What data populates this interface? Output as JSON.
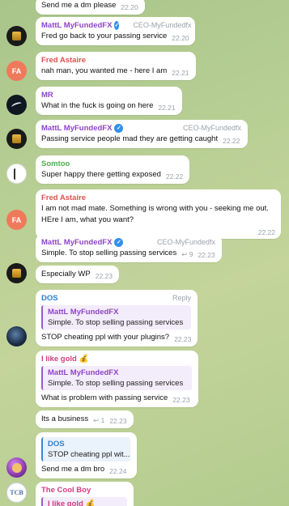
{
  "colors": {
    "matt": "#8e44c9",
    "fred": "#d9534f",
    "mr": "#8e44c9",
    "somtoo": "#4fae4e",
    "dos": "#2f80d1",
    "gold": "#d63b7f",
    "cool": "#d63b7f",
    "verified": "#3390ec"
  },
  "avatars": {
    "fa_initials": "FA",
    "cool_initials": "TCB"
  },
  "messages": {
    "m0": {
      "text": "Send me a dm please",
      "time": "22.20"
    },
    "m1": {
      "sender": "MattL MyFundedFX",
      "badge": "CEO-MyFundedfx",
      "text": "Fred go back to your passing service",
      "time": "22.20"
    },
    "m2": {
      "sender": "Fred Astaire",
      "text": "nah man, you wanted me - here I am",
      "time": "22.21"
    },
    "m3": {
      "sender": "MR",
      "text": "What in the fuck is going on here",
      "time": "22.21"
    },
    "m4": {
      "sender": "MattL MyFundedFX",
      "badge": "CEO-MyFundedfx",
      "text": "Passing service people mad they are getting caught",
      "time": "22.22"
    },
    "m5": {
      "sender": "Somtoo",
      "text": "Super happy there getting exposed",
      "time": "22.22"
    },
    "m6": {
      "sender": "Fred Astaire",
      "text": "I am not mad mate. Something is wrong with you - seeking me out. HEre I am, what you want?",
      "time": "22.22"
    },
    "m7": {
      "sender": "MattL MyFundedFX",
      "badge": "CEO-MyFundedfx",
      "text": "Simple. To stop selling passing services",
      "replies": "9",
      "time": "22.23"
    },
    "m8": {
      "text": "Especially WP",
      "time": "22.23"
    },
    "m9": {
      "sender": "DOS",
      "action": "Reply",
      "quote_name": "MattL MyFundedFX",
      "quote_text": "Simple. To stop selling passing services",
      "text": "STOP cheating ppl with your plugins?",
      "time": "22.23"
    },
    "m10": {
      "sender": "I like gold",
      "emoji": "💰",
      "quote_name": "MattL MyFundedFX",
      "quote_text": "Simple. To stop selling passing services",
      "text": "What is problem with passing service",
      "time": "22.23"
    },
    "m11": {
      "text": "Its a business",
      "replies": "1",
      "time": "22.23"
    },
    "m12": {
      "quote_name": "DOS",
      "quote_text": "STOP cheating ppl wit...",
      "text": "Send me a dm bro",
      "time": "22.24"
    },
    "m13": {
      "sender": "The Cool Boy",
      "quote_name": "I like gold 💰"
    }
  }
}
